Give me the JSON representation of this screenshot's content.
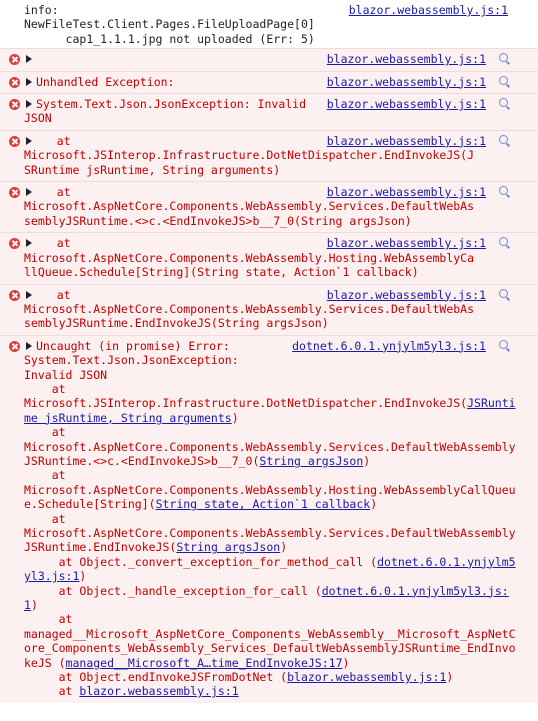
{
  "info": {
    "text": "info:\nNewFileTest.Client.Pages.FileUploadPage[0]\n      cap1_1.1.1.jpg not uploaded (Err: 5)",
    "source": "blazor.webassembly.js:1"
  },
  "errors": [
    {
      "text": "",
      "source": "blazor.webassembly.js:1"
    },
    {
      "text": "Unhandled Exception:",
      "source": "blazor.webassembly.js:1"
    },
    {
      "text": "System.Text.Json.JsonException: Invalid\nJSON",
      "source": "blazor.webassembly.js:1"
    },
    {
      "text": "   at\nMicrosoft.JSInterop.Infrastructure.DotNetDispatcher.EndInvokeJS(JSRuntime jsRuntime, String arguments)",
      "source": "blazor.webassembly.js:1"
    },
    {
      "text": "   at\nMicrosoft.AspNetCore.Components.WebAssembly.Services.DefaultWebAssemblyJSRuntime.<>c.<EndInvokeJS>b__7_0(String argsJson)",
      "source": "blazor.webassembly.js:1"
    },
    {
      "text": "   at\nMicrosoft.AspNetCore.Components.WebAssembly.Hosting.WebAssemblyCallQueue.Schedule[String](String state, Action`1 callback)",
      "source": "blazor.webassembly.js:1"
    },
    {
      "text": "   at\nMicrosoft.AspNetCore.Components.WebAssembly.Services.DefaultWebAssemblyJSRuntime.EndInvokeJS(String argsJson)",
      "source": "blazor.webassembly.js:1"
    }
  ],
  "uncaught": {
    "head": "Uncaught (in promise) Error:",
    "source": "dotnet.6.0.1.ynjylm5yl3.js:1",
    "lines": [
      {
        "pre": "System.Text.Json.JsonException:\nInvalid JSON\n    at\nMicrosoft.JSInterop.Infrastructure.DotNetDispatcher.EndInvokeJS(",
        "link": "JSRuntime jsRuntime, String arguments",
        "post": ")"
      },
      {
        "pre": "\n    at\nMicrosoft.AspNetCore.Components.WebAssembly.Services.DefaultWebAssemblyJSRuntime.<>c.<EndInvokeJS>b__7_0(",
        "link": "String argsJson",
        "post": ")"
      },
      {
        "pre": "\n    at\nMicrosoft.AspNetCore.Components.WebAssembly.Hosting.WebAssemblyCallQueue.Schedule[String](",
        "link": "String state, Action`1 callback",
        "post": ")"
      },
      {
        "pre": "\n    at\nMicrosoft.AspNetCore.Components.WebAssembly.Services.DefaultWebAssemblyJSRuntime.EndInvokeJS(",
        "link": "String argsJson",
        "post": ")"
      },
      {
        "pre": "\n     at Object._convert_exception_for_method_call (",
        "link": "dotnet.6.0.1.ynjylm5yl3.js:1",
        "post": ")"
      },
      {
        "pre": "\n     at Object._handle_exception_for_call (",
        "link": "dotnet.6.0.1.ynjylm5yl3.js:1",
        "post": ")"
      },
      {
        "pre": "\n     at\nmanaged__Microsoft_AspNetCore_Components_WebAssembly__Microsoft_AspNetCore_Components_WebAssembly_Services_DefaultWebAssemblyJSRuntime_EndInvokeJS (",
        "link": "managed__Microsoft_A…time_EndInvokeJS:17",
        "post": ")"
      },
      {
        "pre": "\n     at Object.endInvokeJSFromDotNet (",
        "link": "blazor.webassembly.js:1",
        "post": ")"
      },
      {
        "pre": "\n     at ",
        "link": "blazor.webassembly.js:1",
        "post": ""
      }
    ]
  }
}
